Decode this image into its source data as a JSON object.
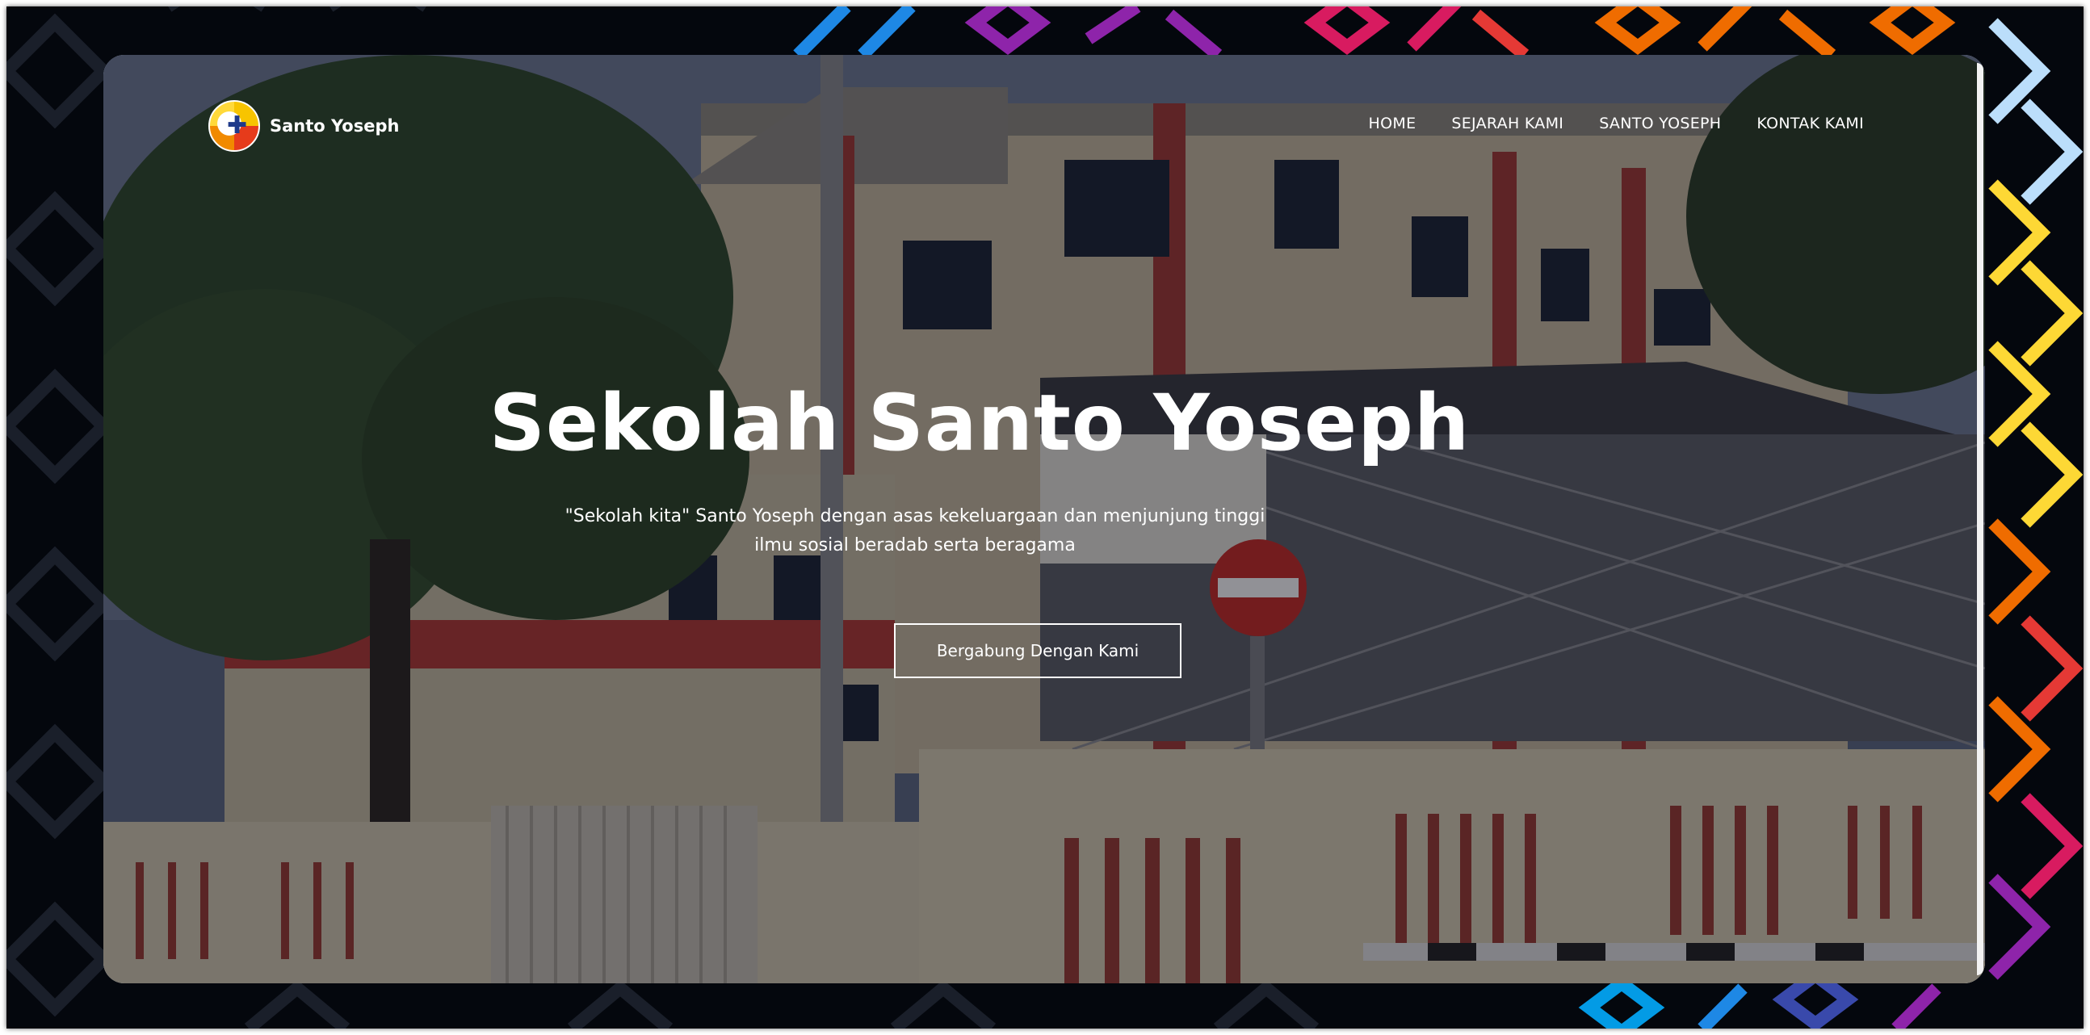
{
  "brand": {
    "name": "Santo Yoseph"
  },
  "nav": {
    "items": [
      {
        "label": "HOME"
      },
      {
        "label": "SEJARAH KAMI"
      },
      {
        "label": "SANTO YOSEPH"
      },
      {
        "label": "KONTAK KAMI"
      }
    ]
  },
  "hero": {
    "title": "Sekolah Santo Yoseph",
    "subtitle_line1": "\"Sekolah kita\" Santo Yoseph dengan asas kekeluargaan dan menjunjung tinggi",
    "subtitle_line2": "ilmu sosial beradab serta beragama",
    "cta_label": "Bergabung Dengan Kami"
  },
  "colors": {
    "text": "#ffffff",
    "background": "#04070d",
    "overlay": "#0a0c16"
  },
  "icons": {
    "logo": "school-crest-icon"
  }
}
